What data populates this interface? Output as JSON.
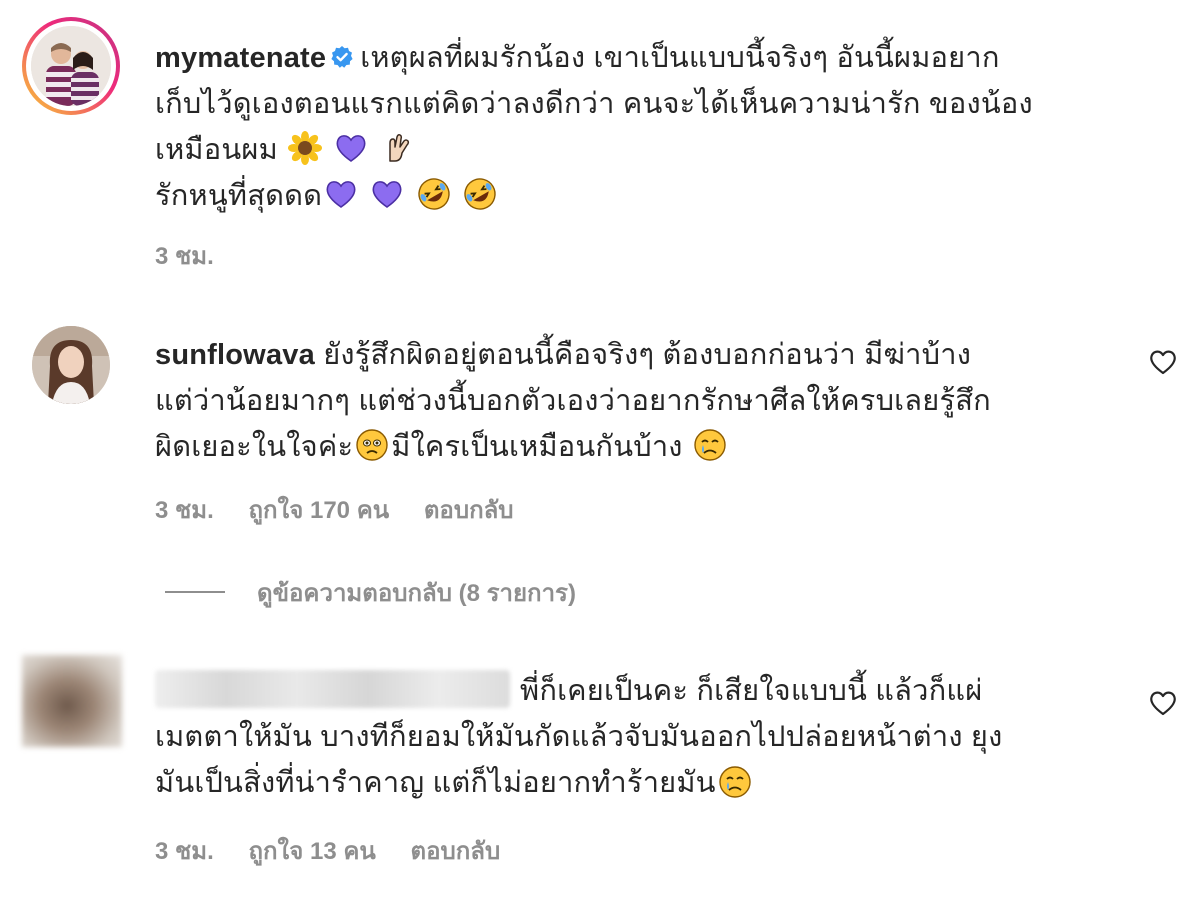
{
  "caption": {
    "username": "mymatenate",
    "lines": [
      "เหตุผลที่ผมรักน้อง เขาเป็นแบบนี้จริงๆ อันนี้ผมอยาก",
      "เก็บไว้ดูเองตอนแรกแต่คิดว่าลงดีกว่า คนจะได้เห็นความน่ารัก ของน้อง",
      "เหมือนผม",
      "รักหนูที่สุดดด"
    ],
    "time": "3 ชม.",
    "emoji_line3": [
      "sunflower-emoji",
      "purple-heart-emoji",
      "love-you-gesture-emoji"
    ],
    "emoji_line4": [
      "purple-heart-emoji",
      "purple-heart-emoji",
      "rolling-laughing-emoji",
      "rolling-laughing-emoji"
    ]
  },
  "comments": [
    {
      "username": "sunflowava",
      "lines": [
        "ยังรู้สึกผิดอยู่ตอนนี้คือจริงๆ ต้องบอกก่อนว่า มีฆ่าบ้าง",
        "แต่ว่าน้อยมากๆ แต่ช่วงนี้บอกตัวเองว่าอยากรักษาศีลให้ครบเลยรู้สึก",
        "ผิดเยอะในใจค่ะ",
        "มีใครเป็นเหมือนกันบ้าง"
      ],
      "time": "3 ชม.",
      "likes": "ถูกใจ 170 คน",
      "reply": "ตอบกลับ",
      "view_replies": "ดูข้อความตอบกลับ (8 รายการ)"
    },
    {
      "username": "",
      "lines": [
        "พี่ก็เคยเป็นคะ ก็เสียใจแบบนี้ แล้วก็แผ่",
        "เมตตาให้มัน บางทีก็ยอมให้มันกัดแล้วจับมันออกไปปล่อยหน้าต่าง ยุง",
        "มันเป็นสิ่งที่น่ารำคาญ แต่ก็ไม่อยากทำร้ายมัน"
      ],
      "time": "3 ชม.",
      "likes": "ถูกใจ 13 คน",
      "reply": "ตอบกลับ"
    }
  ],
  "colors": {
    "text": "#262626",
    "secondary": "#8e8e8e",
    "verified": "#3897f0",
    "purple_heart": "#8c6cf0",
    "story_ring_start": "#f9ce34",
    "story_ring_end": "#ee2a7b"
  }
}
